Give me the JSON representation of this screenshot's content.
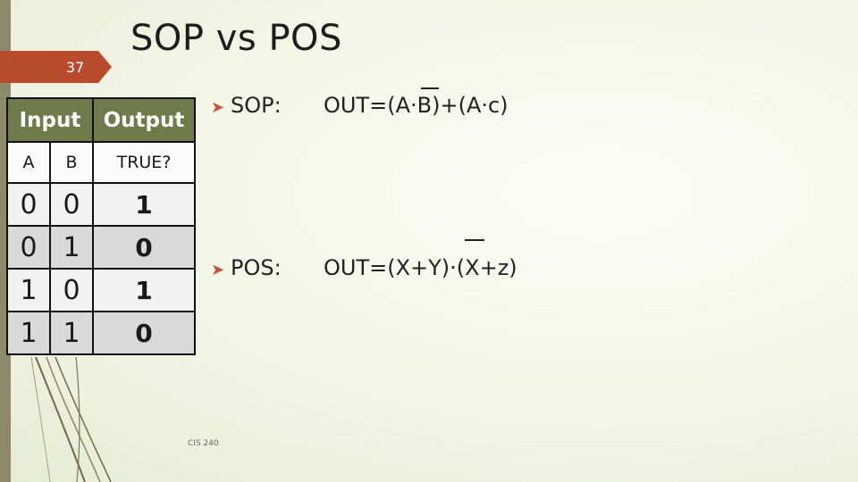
{
  "slide": {
    "title": "SOP vs POS",
    "number": "37",
    "footer": "CIS 240",
    "accent_color": "#b84a2e",
    "header_color": "#6f7b4b"
  },
  "table": {
    "header": {
      "input": "Input",
      "output": "Output"
    },
    "subheader": {
      "a": "A",
      "b": "B",
      "out": "TRUE?"
    },
    "rows": [
      {
        "a": "0",
        "b": "0",
        "out": "1"
      },
      {
        "a": "0",
        "b": "1",
        "out": "0"
      },
      {
        "a": "1",
        "b": "0",
        "out": "1"
      },
      {
        "a": "1",
        "b": "1",
        "out": "0"
      }
    ]
  },
  "bullets": [
    {
      "icon": "arrow-bullet-icon",
      "label": "SOP:",
      "expression": "OUT=(A·B)+(A·c)"
    },
    {
      "icon": "arrow-bullet-icon",
      "label": "POS:",
      "expression": "OUT=(X+Y)·(X+z)"
    }
  ]
}
